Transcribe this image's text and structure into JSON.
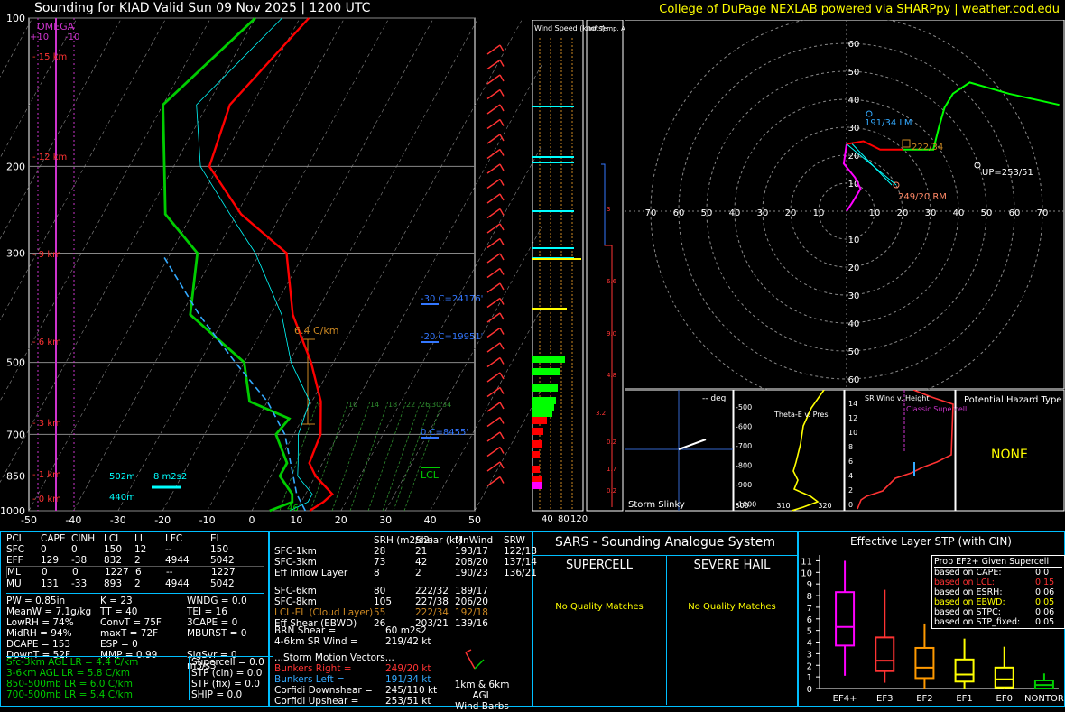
{
  "header": {
    "title": "Sounding for KIAD Valid  Sun 09 Nov 2025 | 1200 UTC",
    "credit": "College of DuPage NEXLAB powered via SHARPpy | weather.cod.edu"
  },
  "colors": {
    "temperature": "#ff0000",
    "temp_dark": "#990000",
    "dewpoint": "#00cc00",
    "parcel": "#33aaff",
    "wetbulb": "#00ffff",
    "omega": "#cc33cc",
    "accent_blue": "#00bfff",
    "yellow": "#ffff00"
  },
  "skewt": {
    "pressure_labels": [
      "100",
      "200",
      "300",
      "500",
      "700",
      "850",
      "1000"
    ],
    "height_labels": [
      "15 km",
      "12 km",
      "9 km",
      "6 km",
      "3 km",
      "1 km",
      "0 km"
    ],
    "temp_ticks": [
      "-50",
      "-40",
      "-30",
      "-20",
      "-10",
      "0",
      "10",
      "20",
      "30",
      "40",
      "50"
    ],
    "omega_label": "OMEGA",
    "omega_ticks": [
      "+10",
      "-10"
    ],
    "lapse_label": "6.4 C/km",
    "isotherm_labels": [
      "-30 C=24176'",
      "-20 C=19951'",
      "0 C=8455'"
    ],
    "mix_labels": [
      "6",
      "10",
      "14",
      "18",
      "22",
      "26",
      "30",
      "34"
    ],
    "lcl_label": "LCL",
    "sfc_label_1": "502m",
    "sfc_label_2": "440m",
    "sfc_label_3": "8 m2s2",
    "sfc_label_4": "46"
  },
  "chart_data": [
    {
      "type": "line",
      "title": "Sounding for KIAD Valid  Sun 09 Nov 2025 | 1200 UTC",
      "xlabel": "",
      "ylabel": "",
      "xlim": [
        -50,
        50
      ],
      "ylim": [
        1000,
        100
      ],
      "yscale": "log",
      "series": [
        {
          "key": "temperature",
          "x": [
            13,
            15,
            16,
            10,
            7,
            6,
            2,
            -5,
            -15,
            -24,
            -39,
            -52,
            -55,
            -48
          ],
          "y": [
            1000,
            960,
            925,
            850,
            800,
            700,
            600,
            500,
            400,
            300,
            250,
            200,
            150,
            100
          ]
        },
        {
          "key": "dewpoint",
          "x": [
            4,
            8,
            7,
            2,
            2,
            -4,
            -3,
            -14,
            -20,
            -38,
            -44,
            -56,
            -70,
            -60
          ],
          "y": [
            1000,
            960,
            925,
            850,
            800,
            700,
            650,
            600,
            500,
            400,
            300,
            250,
            150,
            100
          ]
        },
        {
          "key": "parcel",
          "x": [
            12,
            8,
            5,
            -2,
            -10,
            -22,
            -36,
            -52
          ],
          "y": [
            1000,
            925,
            850,
            700,
            600,
            500,
            400,
            300
          ]
        }
      ]
    },
    {
      "type": "line",
      "title": "",
      "xlabel": "",
      "ylabel": "",
      "xlim": [
        -70,
        70
      ],
      "ylim": [
        -70,
        70
      ],
      "series": [
        {
          "key": "hodo_0_3",
          "x": [
            0,
            2,
            5,
            3,
            -1,
            0
          ],
          "y": [
            0,
            3,
            8,
            12,
            17,
            24
          ]
        },
        {
          "key": "hodo_3_6",
          "x": [
            0,
            6,
            12,
            20
          ],
          "y": [
            24,
            25,
            22,
            22
          ]
        },
        {
          "key": "hodo_upper",
          "x": [
            20,
            31,
            33,
            35,
            38,
            44,
            58,
            76
          ],
          "y": [
            22,
            22,
            30,
            37,
            42,
            46,
            42,
            38
          ]
        }
      ],
      "rings": [
        "10",
        "20",
        "30",
        "40",
        "50",
        "60",
        "70"
      ],
      "annotations": [
        "191/34 LM",
        "222/34",
        "UP=253/51",
        "249/20 RM"
      ]
    }
  ],
  "wind_panel": {
    "title_speed": "Wind Speed (knots)",
    "title_adv": "Inf. Temp. Adv.(C/hr)",
    "speed_ticks": [
      "40",
      "80",
      "120"
    ],
    "adv_values": [
      "3",
      "6.6",
      "9.0",
      "4.8",
      "3.2",
      "0.2",
      "1.7",
      "0.2"
    ]
  },
  "thermo": {
    "headers": [
      "PCL",
      "CAPE",
      "CINH",
      "LCL",
      "LI",
      "LFC",
      "EL"
    ],
    "rows": [
      {
        "pcl": "SFC",
        "cape": "0",
        "cinh": "0",
        "lcl": "150",
        "li": "12",
        "lfc": "--",
        "el": "150"
      },
      {
        "pcl": "EFF",
        "cape": "129",
        "cinh": "-38",
        "lcl": "832",
        "li": "2",
        "lfc": "4944",
        "el": "5042"
      },
      {
        "pcl": "ML",
        "cape": "0",
        "cinh": "0",
        "lcl": "1227",
        "li": "6",
        "lfc": "--",
        "el": "1227"
      },
      {
        "pcl": "MU",
        "cape": "131",
        "cinh": "-33",
        "lcl": "893",
        "li": "2",
        "lfc": "4944",
        "el": "5042"
      }
    ],
    "col1": [
      "PW = 0.85in",
      "MeanW = 7.1g/kg",
      "LowRH = 74%",
      "MidRH = 94%",
      "DCAPE = 153",
      "DownT = 52F"
    ],
    "col2": [
      "K = 23",
      "TT = 40",
      "ConvT = 75F",
      "maxT = 72F",
      "ESP = 0",
      "MMP = 0.99"
    ],
    "col3": [
      "WNDG = 0.0",
      "TEI = 16",
      "3CAPE = 0",
      "MBURST = 0",
      "",
      "SigSvr = 0 m3/s3"
    ],
    "lapse": [
      "Sfc-3km AGL LR = 4.4 C/km",
      "3-6km AGL LR = 5.8 C/km",
      "850-500mb LR = 6.0 C/km",
      "700-500mb LR = 5.4 C/km"
    ],
    "params": [
      "Supercell = 0.0",
      "STP (cin) = 0.0",
      "STP (fix) = 0.0",
      "SHIP = 0.0"
    ]
  },
  "kinematics": {
    "headers": [
      "SRH (m2/s2)",
      "Shear (kt)",
      "MnWind",
      "SRW"
    ],
    "rows": [
      {
        "label": "SFC-1km",
        "srh": "28",
        "shear": "21",
        "mnwind": "193/17",
        "srw": "122/18"
      },
      {
        "label": "SFC-3km",
        "srh": "73",
        "shear": "42",
        "mnwind": "208/20",
        "srw": "137/14"
      },
      {
        "label": "Eff Inflow Layer",
        "srh": "8",
        "shear": "2",
        "mnwind": "190/23",
        "srw": "136/21"
      },
      {
        "label": "",
        "srh": "",
        "shear": "",
        "mnwind": "",
        "srw": ""
      },
      {
        "label": "SFC-6km",
        "srh": "80",
        "shear": "222/32",
        "mnwind": "189/17",
        "srw": ""
      },
      {
        "label": "SFC-8km",
        "srh": "105",
        "shear": "227/38",
        "mnwind": "206/20",
        "srw": ""
      },
      {
        "label": "LCL-EL (Cloud Layer)",
        "srh": "55",
        "shear": "222/34",
        "mnwind": "192/18",
        "srw": ""
      },
      {
        "label": "Eff Shear (EBWD)",
        "srh": "26",
        "shear": "203/21",
        "mnwind": "139/16",
        "srw": ""
      }
    ],
    "brn_shear": "BRN Shear =",
    "brn_shear_val": "60 m2s2",
    "sr_wind": "4-6km SR Wind =",
    "sr_wind_val": "219/42 kt",
    "storm_motion_title": "...Storm Motion Vectors...",
    "bunkers_right": "Bunkers Right =",
    "bunkers_right_val": "249/20 kt",
    "bunkers_left": "Bunkers Left =",
    "bunkers_left_val": "191/34 kt",
    "corfidi_down": "Corfidi Downshear =",
    "corfidi_down_val": "245/110 kt",
    "corfidi_up": "Corfidi Upshear =",
    "corfidi_up_val": "253/51 kt",
    "barb_caption_1": "1km & 6km AGL",
    "barb_caption_2": "Wind Barbs"
  },
  "sars": {
    "title": "SARS - Sounding Analogue System",
    "supercell": "SUPERCELL",
    "severe_hail": "SEVERE HAIL",
    "supercell_result": "No Quality Matches",
    "hail_result": "No Quality Matches"
  },
  "stp": {
    "title": "Effective Layer STP (with CIN)",
    "legend_title": "Prob EF2+ Given Supercell",
    "legend": [
      {
        "label": "based on CAPE:",
        "value": "0.0",
        "color": "#ffffff"
      },
      {
        "label": "based on LCL:",
        "value": "0.15",
        "color": "#ff3333"
      },
      {
        "label": "based on ESRH:",
        "value": "0.06",
        "color": "#ffffff"
      },
      {
        "label": "based on EBWD:",
        "value": "0.05",
        "color": "#ffff00"
      },
      {
        "label": "based on STPC:",
        "value": "0.06",
        "color": "#ffffff"
      },
      {
        "label": "based on STP_fixed:",
        "value": "0.05",
        "color": "#ffffff"
      }
    ],
    "y_ticks": [
      "0",
      "1",
      "2",
      "3",
      "4",
      "5",
      "6",
      "7",
      "8",
      "9",
      "10",
      "11"
    ],
    "categories": [
      "EF4+",
      "EF3",
      "EF2",
      "EF1",
      "EF0",
      "NONTOR"
    ],
    "boxes": [
      {
        "name": "EF4+",
        "color": "#ff00ff",
        "min": 1.1,
        "q1": 3.7,
        "med": 5.3,
        "q3": 8.3,
        "max": 11
      },
      {
        "name": "EF3",
        "color": "#ff3333",
        "min": 0.5,
        "q1": 1.5,
        "med": 2.4,
        "q3": 4.4,
        "max": 8.5
      },
      {
        "name": "EF2",
        "color": "#ff9900",
        "min": 0.0,
        "q1": 0.9,
        "med": 1.8,
        "q3": 3.5,
        "max": 5.6
      },
      {
        "name": "EF1",
        "color": "#ffff00",
        "min": 0.0,
        "q1": 0.6,
        "med": 1.2,
        "q3": 2.5,
        "max": 4.3
      },
      {
        "name": "EF0",
        "color": "#ffff00",
        "min": 0.0,
        "q1": 0.1,
        "med": 0.8,
        "q3": 1.8,
        "max": 3.6
      },
      {
        "name": "NONTOR",
        "color": "#00cc00",
        "min": 0.0,
        "q1": 0.0,
        "med": 0.3,
        "q3": 0.7,
        "max": 1.3
      }
    ]
  },
  "small_panels": {
    "storm_slinky": "Storm Slinky",
    "deg": "-- deg",
    "theta_label": "Theta-E v. Pres",
    "theta_p": [
      "500",
      "600",
      "700",
      "800",
      "900"
    ],
    "theta_p_full": [
      "-500",
      "-600",
      "-700",
      "-800",
      "-900",
      "-1000"
    ],
    "theta_x": [
      "300",
      "310",
      "320"
    ],
    "srwind_title": "SR Wind v. Height",
    "srwind_y": [
      "14",
      "12",
      "10",
      "8",
      "6",
      "4",
      "2",
      "0"
    ],
    "srwind_x": [
      "0",
      "20",
      "40",
      "60",
      "80"
    ],
    "classic_supercell": "Classic Supercell",
    "hazard_title": "Potential Hazard Type",
    "hazard_value": "NONE"
  }
}
